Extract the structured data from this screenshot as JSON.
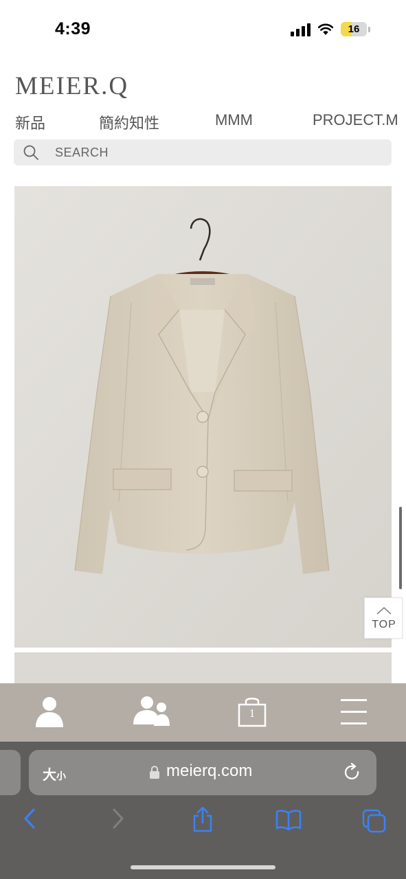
{
  "status_bar": {
    "time": "4:39",
    "battery_level": "16",
    "icons": [
      "signal-icon",
      "wifi-icon",
      "battery-icon"
    ]
  },
  "site": {
    "logo": "MEIER.Q",
    "nav": [
      "新品",
      "簡約知性",
      "MMM",
      "PROJECT.M"
    ],
    "search_placeholder": "SEARCH",
    "product_image": "beige-blazer-photo",
    "top_button_label": "TOP",
    "bottom_bar": {
      "icons": [
        "member-icon",
        "group-icon",
        "cart-icon",
        "menu-icon"
      ],
      "cart_count": "1"
    }
  },
  "browser": {
    "text_size_big": "大",
    "text_size_small": "小",
    "url": "meierq.com",
    "toolbar_icons": [
      "back-icon",
      "forward-icon",
      "share-icon",
      "bookmarks-icon",
      "tabs-icon"
    ]
  },
  "colors": {
    "site_bar": "#b3ada6",
    "browser_bar": "#5f5e5d",
    "accent": "#3b82f6",
    "battery": "#f5d94c"
  }
}
